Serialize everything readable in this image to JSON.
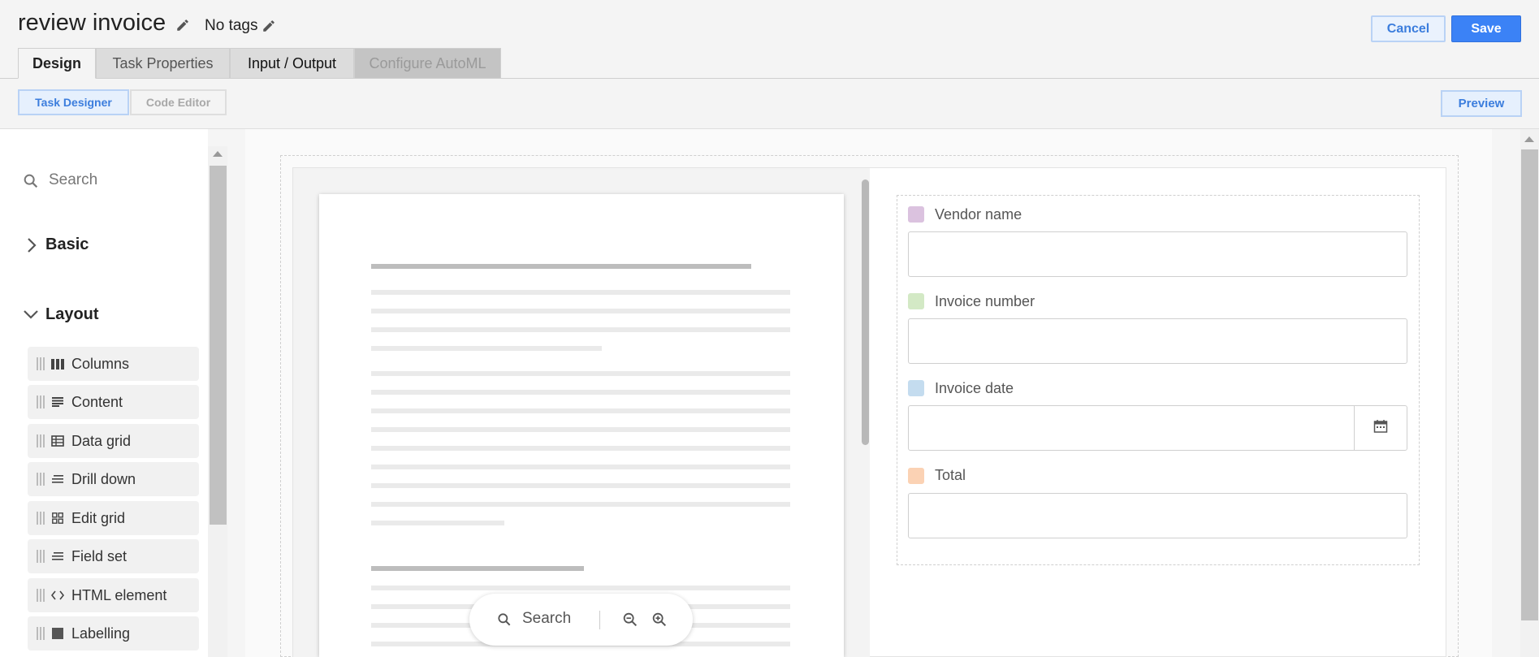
{
  "header": {
    "title": "review invoice",
    "tags_label": "No tags",
    "cancel_label": "Cancel",
    "save_label": "Save"
  },
  "tabs": [
    {
      "label": "Design"
    },
    {
      "label": "Task Properties"
    },
    {
      "label": "Input / Output"
    },
    {
      "label": "Configure AutoML"
    }
  ],
  "subtoolbar": {
    "task_designer_label": "Task Designer",
    "code_editor_label": "Code Editor",
    "preview_label": "Preview"
  },
  "sidebar": {
    "search_placeholder": "Search",
    "groups": [
      {
        "label": "Basic",
        "icon": "chevron-right-icon"
      },
      {
        "label": "Layout",
        "icon": "chevron-down-icon"
      }
    ],
    "items": [
      {
        "label": "Columns",
        "icon": "columns-icon"
      },
      {
        "label": "Content",
        "icon": "content-icon"
      },
      {
        "label": "Data grid",
        "icon": "table-icon"
      },
      {
        "label": "Drill down",
        "icon": "list-icon"
      },
      {
        "label": "Edit grid",
        "icon": "grid-icon"
      },
      {
        "label": "Field set",
        "icon": "list-icon"
      },
      {
        "label": "HTML element",
        "icon": "code-icon"
      },
      {
        "label": "Labelling",
        "icon": "square-icon"
      }
    ]
  },
  "document_viewer": {
    "search_label": "Search"
  },
  "form": {
    "fields": [
      {
        "label": "Vendor name",
        "color": "#d9c3dd",
        "type": "text"
      },
      {
        "label": "Invoice number",
        "color": "#d4e8c8",
        "type": "text"
      },
      {
        "label": "Invoice date",
        "color": "#c6dced",
        "type": "date"
      },
      {
        "label": "Total",
        "color": "#f8d3b7",
        "type": "text"
      }
    ]
  },
  "colors": {
    "accent": "#3b82f6",
    "accent_light": "#e6f0fd"
  }
}
